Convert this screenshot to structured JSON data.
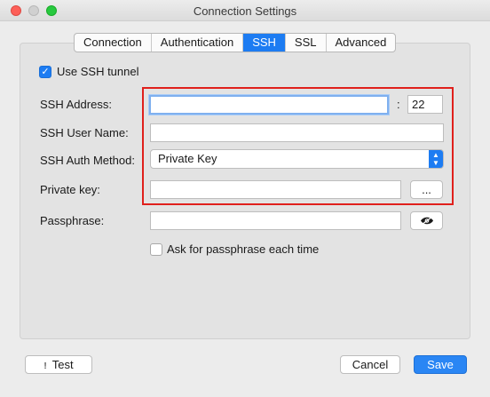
{
  "window": {
    "title": "Connection Settings"
  },
  "tabs": [
    "Connection",
    "Authentication",
    "SSH",
    "SSL",
    "Advanced"
  ],
  "ssh": {
    "use_tunnel_label": "Use SSH tunnel",
    "address_label": "SSH Address:",
    "address_value": "",
    "port_separator": ":",
    "port_value": "22",
    "user_label": "SSH User Name:",
    "user_value": "",
    "auth_method_label": "SSH Auth Method:",
    "auth_method_value": "Private Key",
    "private_key_label": "Private key:",
    "private_key_value": "",
    "browse_label": "...",
    "passphrase_label": "Passphrase:",
    "passphrase_value": "",
    "ask_passphrase_label": "Ask for passphrase each time"
  },
  "footer": {
    "test_icon": "!",
    "test_label": "Test",
    "cancel_label": "Cancel",
    "save_label": "Save"
  },
  "colors": {
    "accent": "#1d7cf2",
    "highlight": "#e0201c"
  }
}
